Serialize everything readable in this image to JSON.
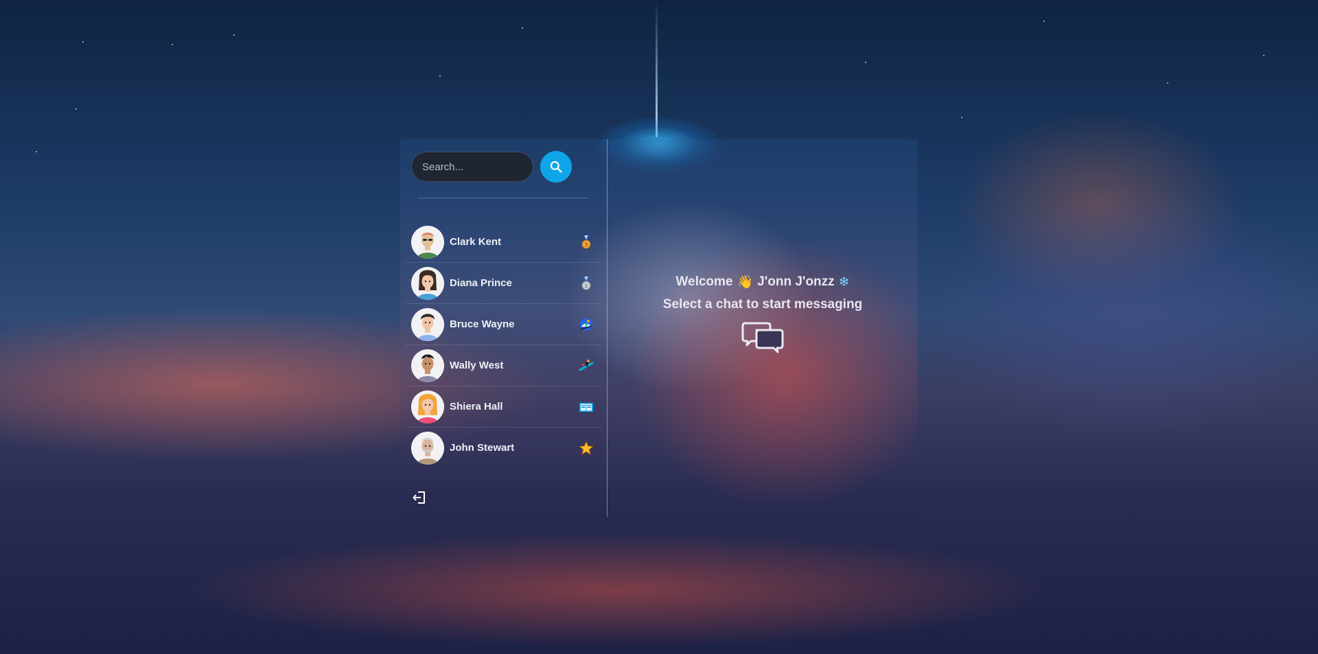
{
  "search": {
    "placeholder": "Search..."
  },
  "contacts": [
    {
      "name": "Clark Kent",
      "badge_icon": "medal-icon",
      "avatar_color": "#e3c29a",
      "shirt_color": "#4e8a4a",
      "hair_color": "#e07a5f"
    },
    {
      "name": "Diana Prince",
      "badge_icon": "silver-medal-icon",
      "avatar_color": "#f3c7a9",
      "shirt_color": "#4a9fd6",
      "hair_color": "#3b2a23"
    },
    {
      "name": "Bruce Wayne",
      "badge_icon": "skier-icon",
      "avatar_color": "#f1c5a4",
      "shirt_color": "#8fb2e8",
      "hair_color": "#2b2b2b"
    },
    {
      "name": "Wally West",
      "badge_icon": "snowboard-icon",
      "avatar_color": "#c9916a",
      "shirt_color": "#8a8aa6",
      "hair_color": "#1d1d1d"
    },
    {
      "name": "Shiera Hall",
      "badge_icon": "book-icon",
      "avatar_color": "#f3c7a9",
      "shirt_color": "#f14d7a",
      "hair_color": "#f2a33a"
    },
    {
      "name": "John Stewart",
      "badge_icon": "star-icon",
      "avatar_color": "#d9b49a",
      "shirt_color": "#b09a7a",
      "hair_color": "#cfcfcf"
    }
  ],
  "welcome": {
    "greeting": "Welcome",
    "wave_emoji": "👋",
    "user_name": "J'onn J'onzz",
    "snow_emoji": "❄",
    "subtitle": "Select a chat to start messaging"
  },
  "colors": {
    "accent": "#0ea5e9",
    "search_bg": "#1f2632",
    "text": "#eef0f5"
  }
}
